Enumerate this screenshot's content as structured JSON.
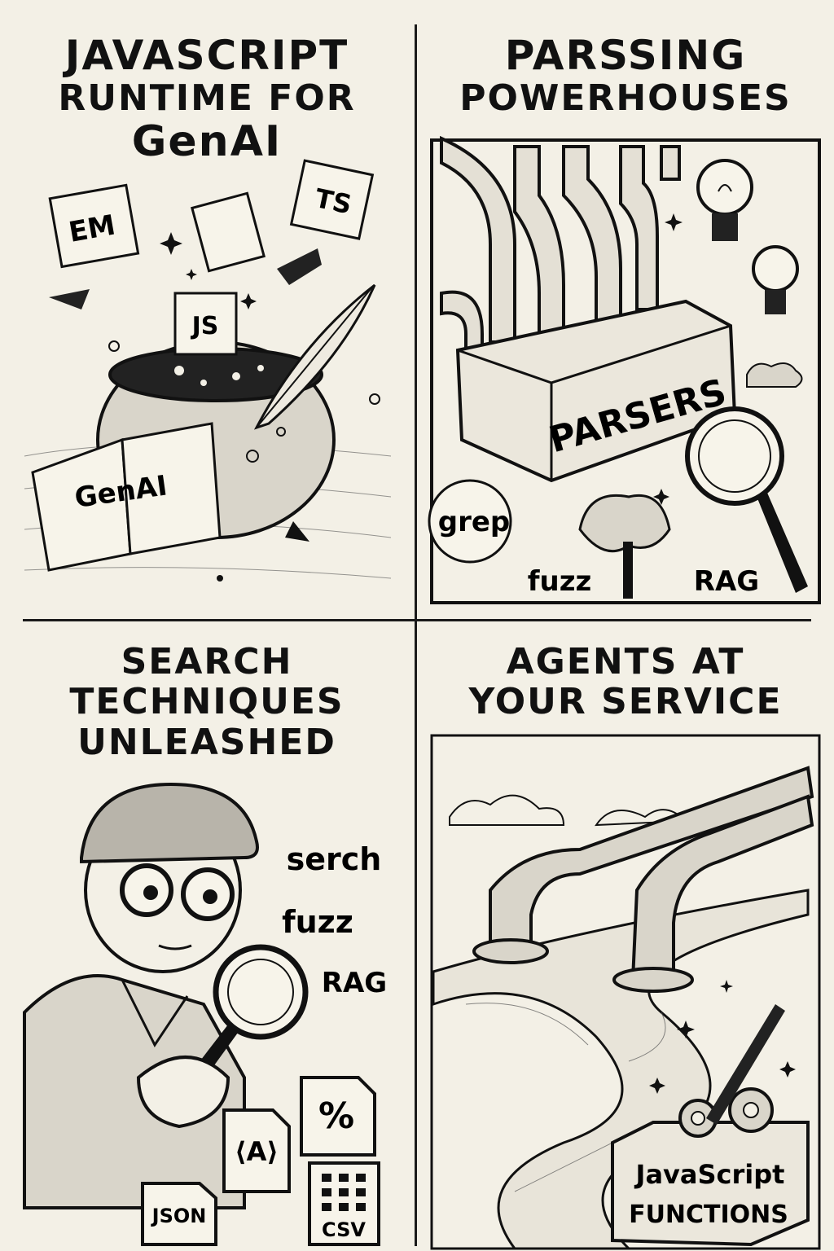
{
  "panels": [
    {
      "title_lines": [
        "JAVASCRIPT",
        "RUNTIME FOR",
        "GenAI"
      ],
      "labels": {
        "em": "EM",
        "ts": "TS",
        "js": "JS",
        "book": "GenAI"
      }
    },
    {
      "title_lines": [
        "PARSSING",
        "POWERHOUSES"
      ],
      "labels": {
        "box": "PARSERS",
        "grep": "grep",
        "fuzz": "fuzz",
        "rag": "RAG"
      }
    },
    {
      "title_lines": [
        "SEARCH",
        "TECHNIQUES",
        "UNLEASHED"
      ],
      "labels": {
        "serch": "serch",
        "fuzz": "fuzz",
        "rag": "RAG",
        "percent": "%",
        "angle": "⟨A⟩",
        "json": "JSON",
        "csv": "CSV"
      }
    },
    {
      "title_lines": [
        "AGENTS AT",
        "YOUR SERVICE"
      ],
      "labels": {
        "box_line1": "JavaScript",
        "box_line2": "FUNCTIONS"
      }
    }
  ],
  "icons": [
    "cauldron-icon",
    "quill-icon",
    "book-icon",
    "pipes-icon",
    "lightbulb-icon",
    "magnifier-icon",
    "tree-icon",
    "detective-icon",
    "gear-icon",
    "river-icon"
  ]
}
